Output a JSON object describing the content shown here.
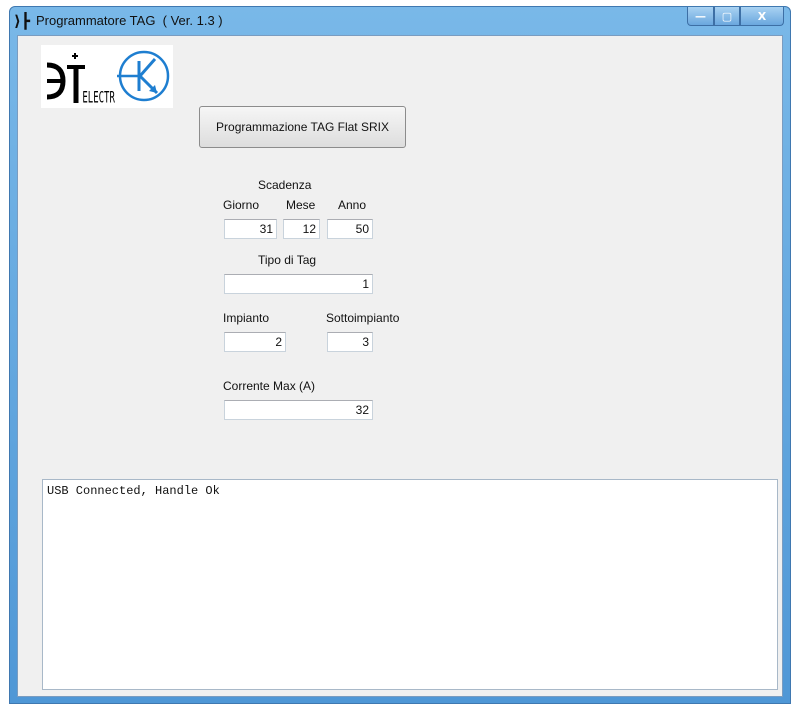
{
  "window": {
    "title": "Programmatore TAG  ( Ver. 1.3 )",
    "app_icon": "electra-logo-icon",
    "controls": {
      "minimize": "—",
      "maximize": "▢",
      "close": "X"
    }
  },
  "logo": {
    "text": "ELECTRA"
  },
  "program_button": {
    "label": "Programmazione TAG Flat SRIX"
  },
  "scadenza": {
    "title": "Scadenza",
    "giorno_label": "Giorno",
    "giorno_value": "31",
    "mese_label": "Mese",
    "mese_value": "12",
    "anno_label": "Anno",
    "anno_value": "50"
  },
  "tipo_tag": {
    "label": "Tipo di Tag",
    "value": "1"
  },
  "impianto": {
    "label": "Impianto",
    "value": "2"
  },
  "sottoimpianto": {
    "label": "Sottoimpianto",
    "value": "3"
  },
  "corrente": {
    "label": "Corrente Max (A)",
    "value": "32"
  },
  "log": {
    "text": "USB Connected, Handle Ok"
  },
  "colors": {
    "title_bar": "#6aa9df",
    "client": "#f0f0f0"
  }
}
